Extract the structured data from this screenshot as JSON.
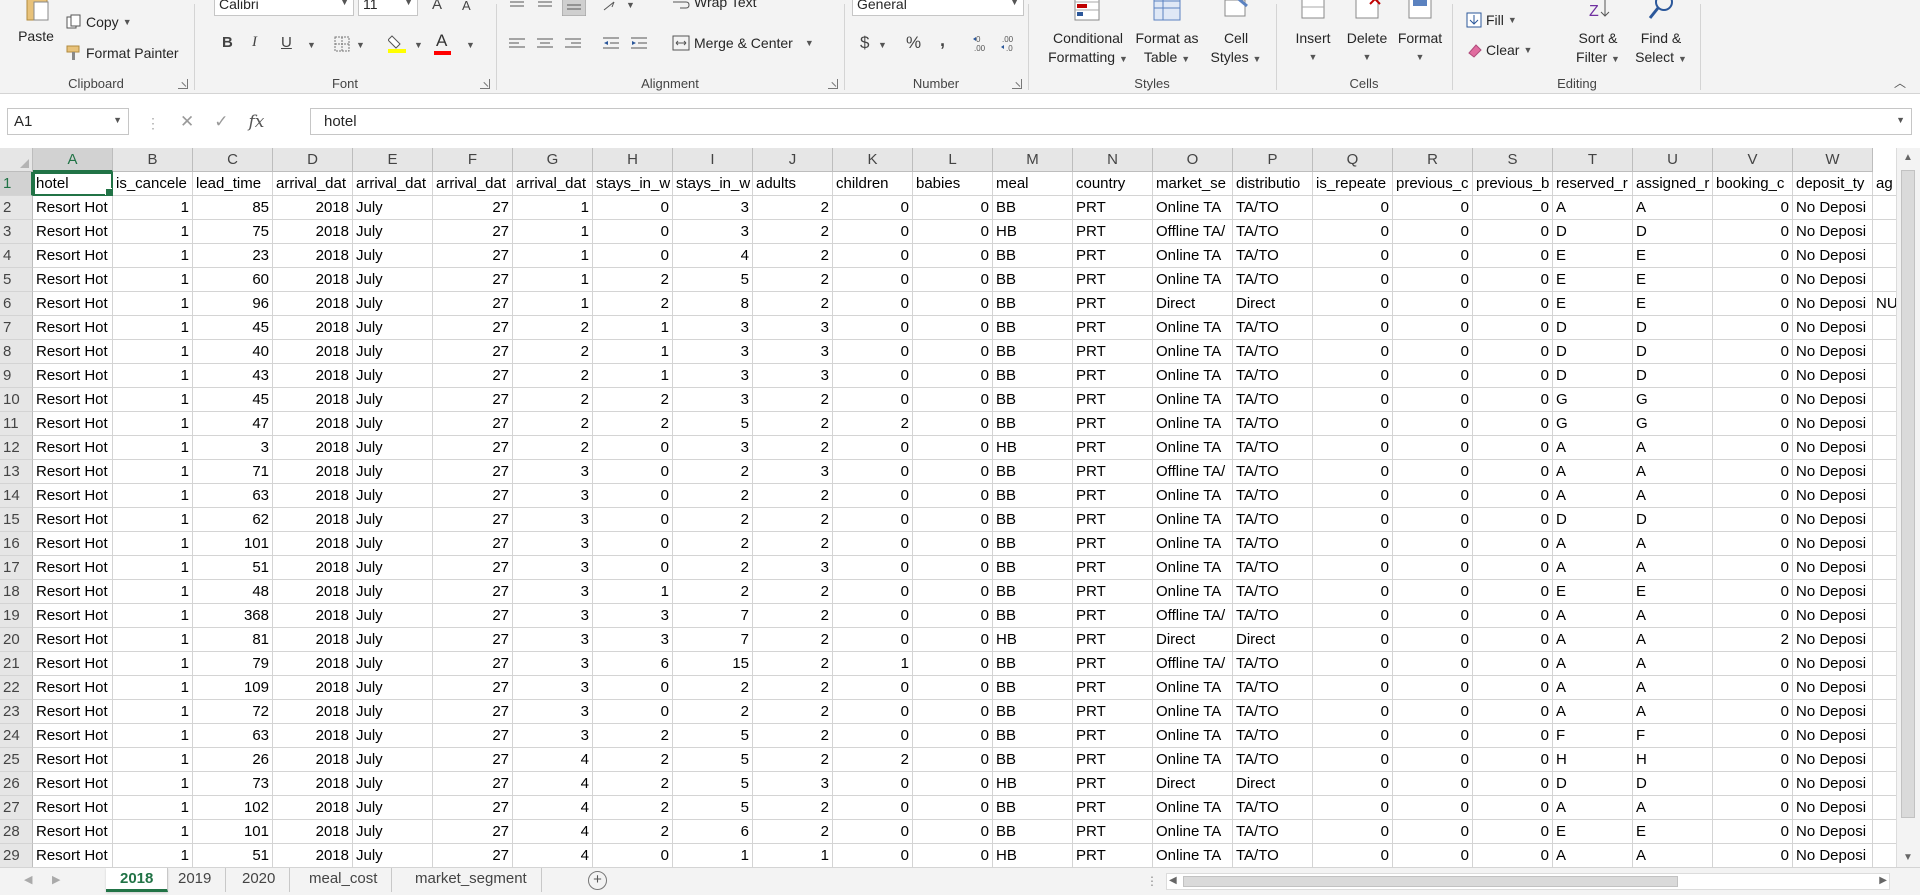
{
  "ribbon": {
    "clipboard": {
      "label": "Clipboard",
      "paste": "Paste",
      "copy": "Copy",
      "format_painter": "Format Painter"
    },
    "font": {
      "label": "Font",
      "font_name": "Calibri",
      "font_size": "11",
      "bold": "B",
      "italic": "I",
      "underline": "U",
      "grow": "A",
      "shrink": "A",
      "font_color": "A",
      "font_color_hex": "#ff0000",
      "fill_color_hex": "#ffff00"
    },
    "alignment": {
      "label": "Alignment",
      "wrap_text": "Wrap Text",
      "merge_center": "Merge & Center"
    },
    "number": {
      "label": "Number",
      "format": "General",
      "currency": "$",
      "percent": "%",
      "comma": ","
    },
    "styles": {
      "label": "Styles",
      "conditional_1": "Conditional",
      "conditional_2": "Formatting",
      "format_as_1": "Format as",
      "format_as_2": "Table",
      "cell_1": "Cell",
      "cell_2": "Styles"
    },
    "cells": {
      "label": "Cells",
      "insert": "Insert",
      "delete": "Delete",
      "format": "Format"
    },
    "editing": {
      "label": "Editing",
      "fill": "Fill",
      "clear": "Clear",
      "sort_1": "Sort &",
      "sort_2": "Filter",
      "find_1": "Find &",
      "find_2": "Select"
    }
  },
  "formula_bar": {
    "name_box": "A1",
    "content": "hotel"
  },
  "columns": [
    "A",
    "B",
    "C",
    "D",
    "E",
    "F",
    "G",
    "H",
    "I",
    "J",
    "K",
    "L",
    "M",
    "N",
    "O",
    "P",
    "Q",
    "R",
    "S",
    "T",
    "U",
    "V",
    "W"
  ],
  "header_row": [
    "hotel",
    "is_cancele",
    "lead_time",
    "arrival_dat",
    "arrival_dat",
    "arrival_dat",
    "arrival_dat",
    "stays_in_w",
    "stays_in_w",
    "adults",
    "children",
    "babies",
    "meal",
    "country",
    "market_se",
    "distributio",
    "is_repeate",
    "previous_c",
    "previous_b",
    "reserved_r",
    "assigned_r",
    "booking_c",
    "deposit_ty",
    "ag"
  ],
  "rows": [
    {
      "n": "2",
      "v": [
        "Resort Hot",
        "1",
        "85",
        "2018",
        "July",
        "27",
        "1",
        "0",
        "3",
        "2",
        "0",
        "0",
        "BB",
        "PRT",
        "Online TA",
        "TA/TO",
        "0",
        "0",
        "0",
        "A",
        "A",
        "0",
        "No Deposi",
        ""
      ]
    },
    {
      "n": "3",
      "v": [
        "Resort Hot",
        "1",
        "75",
        "2018",
        "July",
        "27",
        "1",
        "0",
        "3",
        "2",
        "0",
        "0",
        "HB",
        "PRT",
        "Offline TA/",
        "TA/TO",
        "0",
        "0",
        "0",
        "D",
        "D",
        "0",
        "No Deposi",
        ""
      ]
    },
    {
      "n": "4",
      "v": [
        "Resort Hot",
        "1",
        "23",
        "2018",
        "July",
        "27",
        "1",
        "0",
        "4",
        "2",
        "0",
        "0",
        "BB",
        "PRT",
        "Online TA",
        "TA/TO",
        "0",
        "0",
        "0",
        "E",
        "E",
        "0",
        "No Deposi",
        ""
      ]
    },
    {
      "n": "5",
      "v": [
        "Resort Hot",
        "1",
        "60",
        "2018",
        "July",
        "27",
        "1",
        "2",
        "5",
        "2",
        "0",
        "0",
        "BB",
        "PRT",
        "Online TA",
        "TA/TO",
        "0",
        "0",
        "0",
        "E",
        "E",
        "0",
        "No Deposi",
        ""
      ]
    },
    {
      "n": "6",
      "v": [
        "Resort Hot",
        "1",
        "96",
        "2018",
        "July",
        "27",
        "1",
        "2",
        "8",
        "2",
        "0",
        "0",
        "BB",
        "PRT",
        "Direct",
        "Direct",
        "0",
        "0",
        "0",
        "E",
        "E",
        "0",
        "No Deposi",
        "NU"
      ]
    },
    {
      "n": "7",
      "v": [
        "Resort Hot",
        "1",
        "45",
        "2018",
        "July",
        "27",
        "2",
        "1",
        "3",
        "3",
        "0",
        "0",
        "BB",
        "PRT",
        "Online TA",
        "TA/TO",
        "0",
        "0",
        "0",
        "D",
        "D",
        "0",
        "No Deposi",
        ""
      ]
    },
    {
      "n": "8",
      "v": [
        "Resort Hot",
        "1",
        "40",
        "2018",
        "July",
        "27",
        "2",
        "1",
        "3",
        "3",
        "0",
        "0",
        "BB",
        "PRT",
        "Online TA",
        "TA/TO",
        "0",
        "0",
        "0",
        "D",
        "D",
        "0",
        "No Deposi",
        ""
      ]
    },
    {
      "n": "9",
      "v": [
        "Resort Hot",
        "1",
        "43",
        "2018",
        "July",
        "27",
        "2",
        "1",
        "3",
        "3",
        "0",
        "0",
        "BB",
        "PRT",
        "Online TA",
        "TA/TO",
        "0",
        "0",
        "0",
        "D",
        "D",
        "0",
        "No Deposi",
        ""
      ]
    },
    {
      "n": "10",
      "v": [
        "Resort Hot",
        "1",
        "45",
        "2018",
        "July",
        "27",
        "2",
        "2",
        "3",
        "2",
        "0",
        "0",
        "BB",
        "PRT",
        "Online TA",
        "TA/TO",
        "0",
        "0",
        "0",
        "G",
        "G",
        "0",
        "No Deposi",
        ""
      ]
    },
    {
      "n": "11",
      "v": [
        "Resort Hot",
        "1",
        "47",
        "2018",
        "July",
        "27",
        "2",
        "2",
        "5",
        "2",
        "2",
        "0",
        "BB",
        "PRT",
        "Online TA",
        "TA/TO",
        "0",
        "0",
        "0",
        "G",
        "G",
        "0",
        "No Deposi",
        ""
      ]
    },
    {
      "n": "12",
      "v": [
        "Resort Hot",
        "1",
        "3",
        "2018",
        "July",
        "27",
        "2",
        "0",
        "3",
        "2",
        "0",
        "0",
        "HB",
        "PRT",
        "Online TA",
        "TA/TO",
        "0",
        "0",
        "0",
        "A",
        "A",
        "0",
        "No Deposi",
        ""
      ]
    },
    {
      "n": "13",
      "v": [
        "Resort Hot",
        "1",
        "71",
        "2018",
        "July",
        "27",
        "3",
        "0",
        "2",
        "3",
        "0",
        "0",
        "BB",
        "PRT",
        "Offline TA/",
        "TA/TO",
        "0",
        "0",
        "0",
        "A",
        "A",
        "0",
        "No Deposi",
        ""
      ]
    },
    {
      "n": "14",
      "v": [
        "Resort Hot",
        "1",
        "63",
        "2018",
        "July",
        "27",
        "3",
        "0",
        "2",
        "2",
        "0",
        "0",
        "BB",
        "PRT",
        "Online TA",
        "TA/TO",
        "0",
        "0",
        "0",
        "A",
        "A",
        "0",
        "No Deposi",
        ""
      ]
    },
    {
      "n": "15",
      "v": [
        "Resort Hot",
        "1",
        "62",
        "2018",
        "July",
        "27",
        "3",
        "0",
        "2",
        "2",
        "0",
        "0",
        "BB",
        "PRT",
        "Online TA",
        "TA/TO",
        "0",
        "0",
        "0",
        "D",
        "D",
        "0",
        "No Deposi",
        ""
      ]
    },
    {
      "n": "16",
      "v": [
        "Resort Hot",
        "1",
        "101",
        "2018",
        "July",
        "27",
        "3",
        "0",
        "2",
        "2",
        "0",
        "0",
        "BB",
        "PRT",
        "Online TA",
        "TA/TO",
        "0",
        "0",
        "0",
        "A",
        "A",
        "0",
        "No Deposi",
        ""
      ]
    },
    {
      "n": "17",
      "v": [
        "Resort Hot",
        "1",
        "51",
        "2018",
        "July",
        "27",
        "3",
        "0",
        "2",
        "3",
        "0",
        "0",
        "BB",
        "PRT",
        "Online TA",
        "TA/TO",
        "0",
        "0",
        "0",
        "A",
        "A",
        "0",
        "No Deposi",
        ""
      ]
    },
    {
      "n": "18",
      "v": [
        "Resort Hot",
        "1",
        "48",
        "2018",
        "July",
        "27",
        "3",
        "1",
        "2",
        "2",
        "0",
        "0",
        "BB",
        "PRT",
        "Online TA",
        "TA/TO",
        "0",
        "0",
        "0",
        "E",
        "E",
        "0",
        "No Deposi",
        ""
      ]
    },
    {
      "n": "19",
      "v": [
        "Resort Hot",
        "1",
        "368",
        "2018",
        "July",
        "27",
        "3",
        "3",
        "7",
        "2",
        "0",
        "0",
        "BB",
        "PRT",
        "Offline TA/",
        "TA/TO",
        "0",
        "0",
        "0",
        "A",
        "A",
        "0",
        "No Deposi",
        ""
      ]
    },
    {
      "n": "20",
      "v": [
        "Resort Hot",
        "1",
        "81",
        "2018",
        "July",
        "27",
        "3",
        "3",
        "7",
        "2",
        "0",
        "0",
        "HB",
        "PRT",
        "Direct",
        "Direct",
        "0",
        "0",
        "0",
        "A",
        "A",
        "2",
        "No Deposi",
        ""
      ]
    },
    {
      "n": "21",
      "v": [
        "Resort Hot",
        "1",
        "79",
        "2018",
        "July",
        "27",
        "3",
        "6",
        "15",
        "2",
        "1",
        "0",
        "BB",
        "PRT",
        "Offline TA/",
        "TA/TO",
        "0",
        "0",
        "0",
        "A",
        "A",
        "0",
        "No Deposi",
        ""
      ]
    },
    {
      "n": "22",
      "v": [
        "Resort Hot",
        "1",
        "109",
        "2018",
        "July",
        "27",
        "3",
        "0",
        "2",
        "2",
        "0",
        "0",
        "BB",
        "PRT",
        "Online TA",
        "TA/TO",
        "0",
        "0",
        "0",
        "A",
        "A",
        "0",
        "No Deposi",
        ""
      ]
    },
    {
      "n": "23",
      "v": [
        "Resort Hot",
        "1",
        "72",
        "2018",
        "July",
        "27",
        "3",
        "0",
        "2",
        "2",
        "0",
        "0",
        "BB",
        "PRT",
        "Online TA",
        "TA/TO",
        "0",
        "0",
        "0",
        "A",
        "A",
        "0",
        "No Deposi",
        ""
      ]
    },
    {
      "n": "24",
      "v": [
        "Resort Hot",
        "1",
        "63",
        "2018",
        "July",
        "27",
        "3",
        "2",
        "5",
        "2",
        "0",
        "0",
        "BB",
        "PRT",
        "Online TA",
        "TA/TO",
        "0",
        "0",
        "0",
        "F",
        "F",
        "0",
        "No Deposi",
        ""
      ]
    },
    {
      "n": "25",
      "v": [
        "Resort Hot",
        "1",
        "26",
        "2018",
        "July",
        "27",
        "4",
        "2",
        "5",
        "2",
        "2",
        "0",
        "BB",
        "PRT",
        "Online TA",
        "TA/TO",
        "0",
        "0",
        "0",
        "H",
        "H",
        "0",
        "No Deposi",
        ""
      ]
    },
    {
      "n": "26",
      "v": [
        "Resort Hot",
        "1",
        "73",
        "2018",
        "July",
        "27",
        "4",
        "2",
        "5",
        "3",
        "0",
        "0",
        "HB",
        "PRT",
        "Direct",
        "Direct",
        "0",
        "0",
        "0",
        "D",
        "D",
        "0",
        "No Deposi",
        ""
      ]
    },
    {
      "n": "27",
      "v": [
        "Resort Hot",
        "1",
        "102",
        "2018",
        "July",
        "27",
        "4",
        "2",
        "5",
        "2",
        "0",
        "0",
        "BB",
        "PRT",
        "Online TA",
        "TA/TO",
        "0",
        "0",
        "0",
        "A",
        "A",
        "0",
        "No Deposi",
        ""
      ]
    },
    {
      "n": "28",
      "v": [
        "Resort Hot",
        "1",
        "101",
        "2018",
        "July",
        "27",
        "4",
        "2",
        "6",
        "2",
        "0",
        "0",
        "BB",
        "PRT",
        "Online TA",
        "TA/TO",
        "0",
        "0",
        "0",
        "E",
        "E",
        "0",
        "No Deposi",
        ""
      ]
    },
    {
      "n": "29",
      "v": [
        "Resort Hot",
        "1",
        "51",
        "2018",
        "July",
        "27",
        "4",
        "0",
        "1",
        "1",
        "0",
        "0",
        "HB",
        "PRT",
        "Online TA",
        "TA/TO",
        "0",
        "0",
        "0",
        "A",
        "A",
        "0",
        "No Deposi",
        ""
      ]
    }
  ],
  "sheets": [
    "2018",
    "2019",
    "2020",
    "meal_cost",
    "market_segment"
  ],
  "active_sheet": "2018"
}
